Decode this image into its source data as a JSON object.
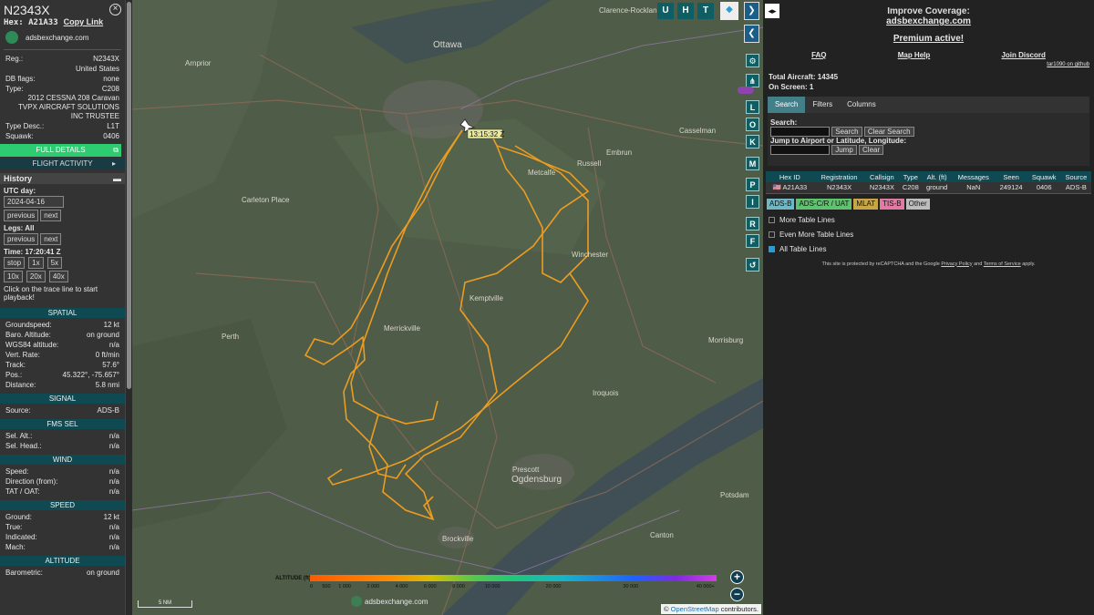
{
  "aircraft": {
    "callsign": "N2343X",
    "hex_label": "Hex:",
    "hex": "A21A33",
    "copy_link": "Copy Link",
    "site": "adsbexchange.com",
    "reg_label": "Reg.:",
    "reg": "N2343X",
    "country": "United States",
    "dbflags_label": "DB flags:",
    "dbflags": "none",
    "type_label": "Type:",
    "type": "C208",
    "model": "2012 CESSNA 208 Caravan",
    "owner": "TVPX AIRCRAFT SOLUTIONS INC TRUSTEE",
    "typedesc_label": "Type Desc.:",
    "typedesc": "L1T",
    "squawk_label": "Squawk:",
    "squawk": "0406"
  },
  "buttons": {
    "full_details": "FULL DETAILS",
    "flight_activity": "FLIGHT ACTIVITY"
  },
  "history": {
    "title": "History",
    "utc_day_label": "UTC day:",
    "utc_day": "2024-04-16",
    "previous": "previous",
    "next": "next",
    "legs_label": "Legs: All",
    "time_label": "Time: 17:20:41 Z",
    "stop": "stop",
    "x1": "1x",
    "x5": "5x",
    "x10": "10x",
    "x20": "20x",
    "x40": "40x",
    "hint": "Click on the trace line to start playback!"
  },
  "spatial": {
    "title": "SPATIAL",
    "rows": [
      [
        "Groundspeed:",
        "12 kt"
      ],
      [
        "Baro. Altitude:",
        "on ground"
      ],
      [
        "WGS84 altitude:",
        "n/a"
      ],
      [
        "Vert. Rate:",
        "0 ft/min"
      ],
      [
        "Track:",
        "57.6°"
      ],
      [
        "Pos.:",
        "45.322°, -75.657°"
      ],
      [
        "Distance:",
        "5.8 nmi"
      ]
    ]
  },
  "signal": {
    "title": "SIGNAL",
    "rows": [
      [
        "Source:",
        "ADS-B"
      ]
    ]
  },
  "fms": {
    "title": "FMS SEL",
    "rows": [
      [
        "Sel. Alt.:",
        "n/a"
      ],
      [
        "Sel. Head.:",
        "n/a"
      ]
    ]
  },
  "wind": {
    "title": "WIND",
    "rows": [
      [
        "Speed:",
        "n/a"
      ],
      [
        "Direction (from):",
        "n/a"
      ],
      [
        "TAT / OAT:",
        "n/a"
      ]
    ]
  },
  "speed": {
    "title": "SPEED",
    "rows": [
      [
        "Ground:",
        "12 kt"
      ],
      [
        "True:",
        "n/a"
      ],
      [
        "Indicated:",
        "n/a"
      ],
      [
        "Mach:",
        "n/a"
      ]
    ]
  },
  "altitude": {
    "title": "ALTITUDE",
    "rows": [
      [
        "Barometric:",
        "on ground"
      ]
    ]
  },
  "map": {
    "plane_label": "13:15:32 Z",
    "places": [
      "Ottawa",
      "Clarence-Rockland",
      "Arnprior",
      "Casselman",
      "Embrun",
      "Russell",
      "Metcalfe",
      "Carleton Place",
      "Winchester",
      "Kemptville",
      "Perth",
      "Merrickville",
      "Morrisburg",
      "Iroquois",
      "Prescott",
      "Ogdensburg",
      "Brockville",
      "Potsdam",
      "Canton"
    ],
    "scale": "5 NM",
    "attribution_prefix": "©",
    "attribution_link": "OpenStreetMap",
    "attribution_suffix": "contributors.",
    "watermark": "adsbexchange.com",
    "legend_title": "ALTITUDE (ft)",
    "legend_ticks": [
      "0",
      "500",
      "1 000",
      "2 000",
      "4 000",
      "6 000",
      "8 000",
      "10 000",
      "20 000",
      "30 000",
      "40 000+"
    ],
    "top_buttons": [
      "U",
      "H",
      "T"
    ],
    "side_buttons": [
      "L",
      "O",
      "K",
      "M",
      "P",
      "I",
      "R",
      "F"
    ],
    "zoom_in": "+",
    "zoom_out": "−"
  },
  "right": {
    "improve": "Improve Coverage:",
    "improve_link": "adsbexchange.com",
    "premium": "Premium active!",
    "faq": "FAQ",
    "map_help": "Map Help",
    "discord": "Join Discord",
    "github": "tar1090 on github",
    "total": "Total Aircraft: 14345",
    "onscreen": "On Screen: 1",
    "tabs": [
      "Search",
      "Filters",
      "Columns"
    ],
    "search_label": "Search:",
    "search_btn": "Search",
    "clear_search": "Clear Search",
    "jump_label": "Jump to Airport or Latitude, Longitude:",
    "jump_btn": "Jump",
    "clear": "Clear",
    "columns": [
      "Hex ID",
      "Registration",
      "Callsign",
      "Type",
      "Alt. (ft)",
      "Messages",
      "Seen",
      "Squawk",
      "Source"
    ],
    "row": [
      "A21A33",
      "N2343X",
      "N2343X",
      "C208",
      "ground",
      "NaN",
      "249124",
      "0406",
      "ADS-B"
    ],
    "filters": [
      "ADS-B",
      "ADS-C/R / UAT",
      "MLAT",
      "TIS-B",
      "Other"
    ],
    "more_lines": "More Table Lines",
    "even_more": "Even More Table Lines",
    "all_lines": "All Table Lines",
    "recaptcha_1": "This site is protected by reCAPTCHA and the Google",
    "privacy": "Privacy Policy",
    "and": "and",
    "terms": "Terms of Service",
    "apply": "apply."
  }
}
